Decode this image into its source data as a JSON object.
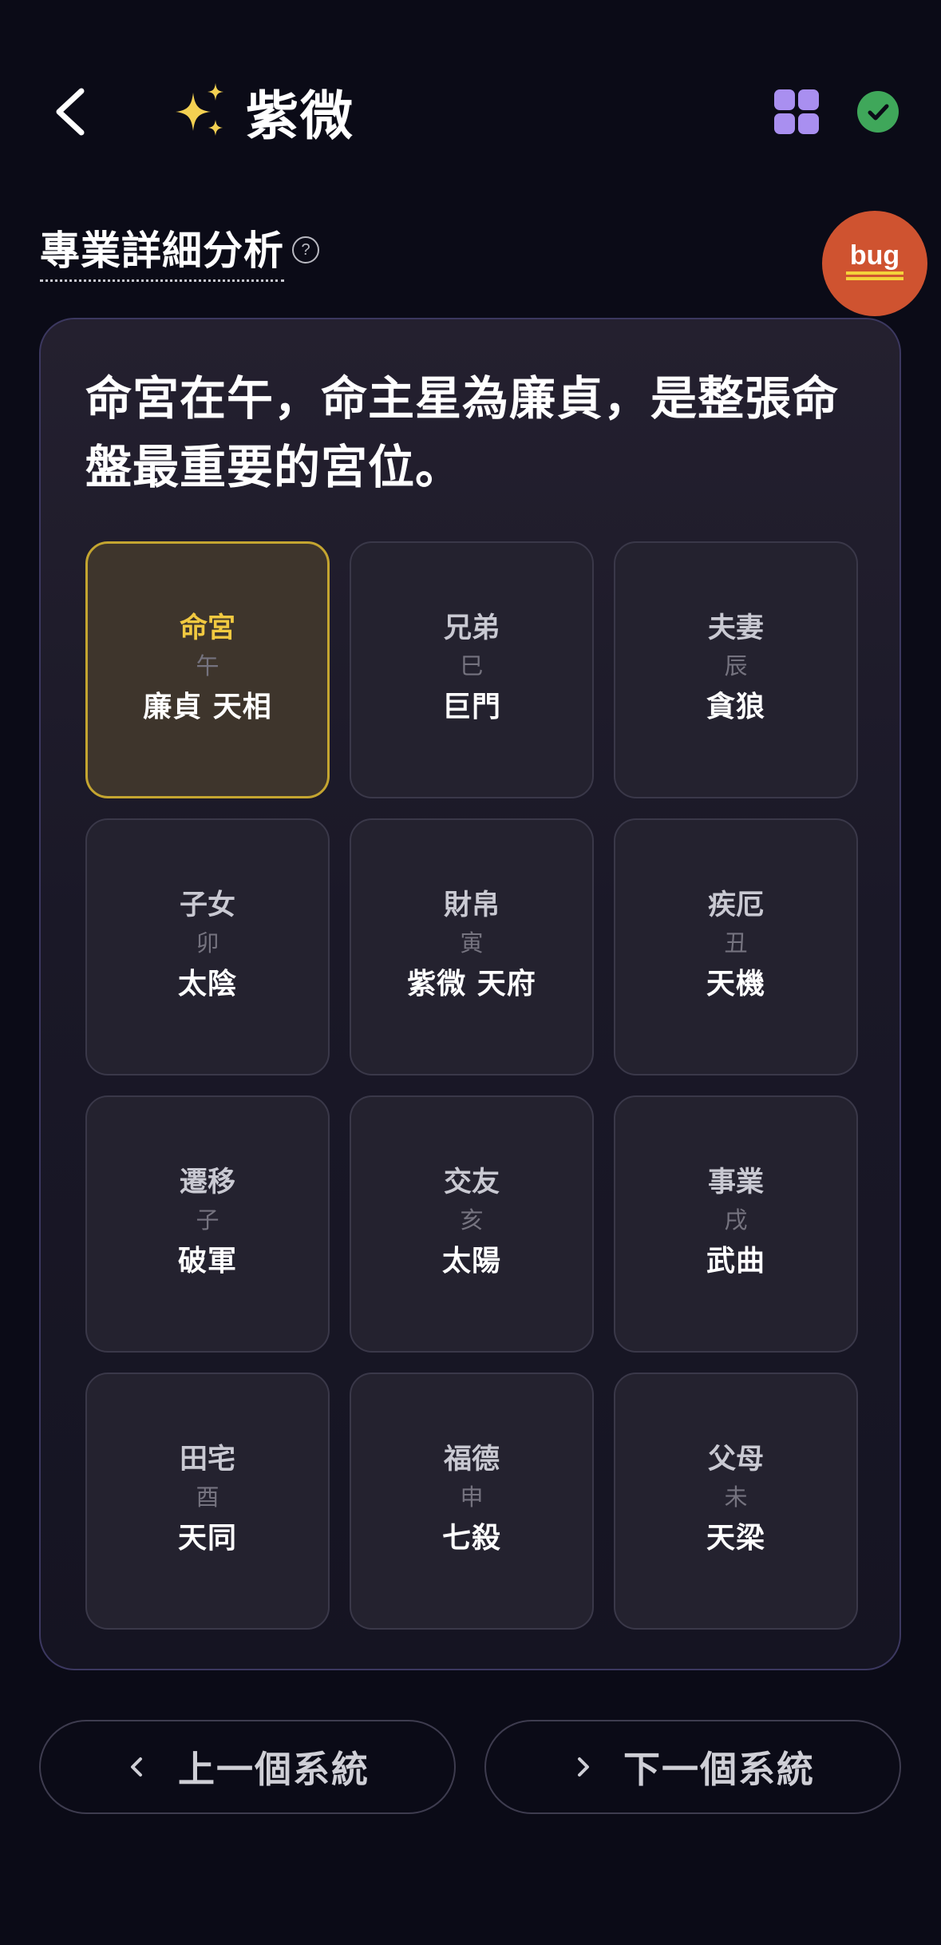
{
  "header": {
    "title": "紫微",
    "back_icon": "chevron-left-icon",
    "sparkle_icon": "sparkles-icon",
    "grid_icon": "grid-icon",
    "status_icon": "check-circle-icon"
  },
  "section": {
    "title": "專業詳細分析",
    "help_icon": "question-circle-icon",
    "help_glyph": "?"
  },
  "bug_badge": {
    "label": "bug"
  },
  "summary": "命宮在午，命主星為廉貞，是整張命盤最重要的宮位。",
  "palaces": [
    {
      "name": "命宮",
      "branch": "午",
      "stars": "廉貞 天相",
      "active": true
    },
    {
      "name": "兄弟",
      "branch": "巳",
      "stars": "巨門"
    },
    {
      "name": "夫妻",
      "branch": "辰",
      "stars": "貪狼"
    },
    {
      "name": "子女",
      "branch": "卯",
      "stars": "太陰"
    },
    {
      "name": "財帛",
      "branch": "寅",
      "stars": "紫微 天府"
    },
    {
      "name": "疾厄",
      "branch": "丑",
      "stars": "天機"
    },
    {
      "name": "遷移",
      "branch": "子",
      "stars": "破軍"
    },
    {
      "name": "交友",
      "branch": "亥",
      "stars": "太陽"
    },
    {
      "name": "事業",
      "branch": "戌",
      "stars": "武曲"
    },
    {
      "name": "田宅",
      "branch": "酉",
      "stars": "天同"
    },
    {
      "name": "福德",
      "branch": "申",
      "stars": "七殺"
    },
    {
      "name": "父母",
      "branch": "未",
      "stars": "天梁"
    }
  ],
  "nav": {
    "prev_label": "上一個系統",
    "next_label": "下一個系統"
  },
  "colors": {
    "background": "#0b0b17",
    "accent_purple": "#a98ff0",
    "accent_gold": "#f1c940",
    "success_green": "#3fa75a",
    "bug_orange": "#cf5330"
  }
}
